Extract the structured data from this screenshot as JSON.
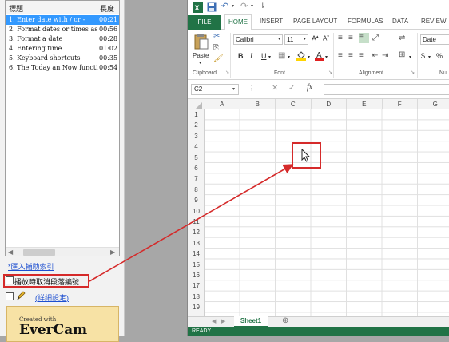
{
  "player": {
    "list": {
      "col_title": "標題",
      "col_duration": "長度",
      "items": [
        {
          "title": "1. Enter date with / or -",
          "duration": "00:21",
          "selected": true
        },
        {
          "title": "2. Format dates or times as text",
          "duration": "00:56",
          "selected": false
        },
        {
          "title": "3. Format a date",
          "duration": "00:28",
          "selected": false
        },
        {
          "title": "4. Entering time",
          "duration": "01:02",
          "selected": false
        },
        {
          "title": "5. Keyboard shortcuts",
          "duration": "00:35",
          "selected": false
        },
        {
          "title": "6. The Today an Now functi…",
          "duration": "00:54",
          "selected": false
        }
      ]
    },
    "import_link": "*匯入輔助索引",
    "option_label": "播放時取消段落編號",
    "settings_link": "(詳細設定)",
    "evercam_small": "Created with",
    "evercam_big": "EverCam"
  },
  "excel": {
    "tabs": {
      "file": "FILE",
      "home": "HOME",
      "insert": "INSERT",
      "page_layout": "PAGE LAYOUT",
      "formulas": "FORMULAS",
      "data": "DATA",
      "review": "REVIEW"
    },
    "ribbon": {
      "paste": "Paste",
      "font_name": "Calibri",
      "font_size": "11",
      "number_format": "Date",
      "bold": "B",
      "italic": "I",
      "underline": "U",
      "currency": "$",
      "percent": "%",
      "groups": {
        "clipboard": "Clipboard",
        "font": "Font",
        "alignment": "Alignment",
        "number": "Nu"
      }
    },
    "name_box": "C2",
    "fx": "fx",
    "columns": [
      "A",
      "B",
      "C",
      "D",
      "E",
      "F",
      "G"
    ],
    "rows": [
      "1",
      "2",
      "3",
      "4",
      "5",
      "6",
      "7",
      "8",
      "9",
      "10",
      "11",
      "12",
      "13",
      "14",
      "15",
      "16",
      "17",
      "18",
      "19"
    ],
    "sheet_tab": "Sheet1",
    "status": "READY"
  },
  "colors": {
    "excel_green": "#217346",
    "annotation_red": "#d52a2a",
    "selection_blue": "#3399ff"
  }
}
